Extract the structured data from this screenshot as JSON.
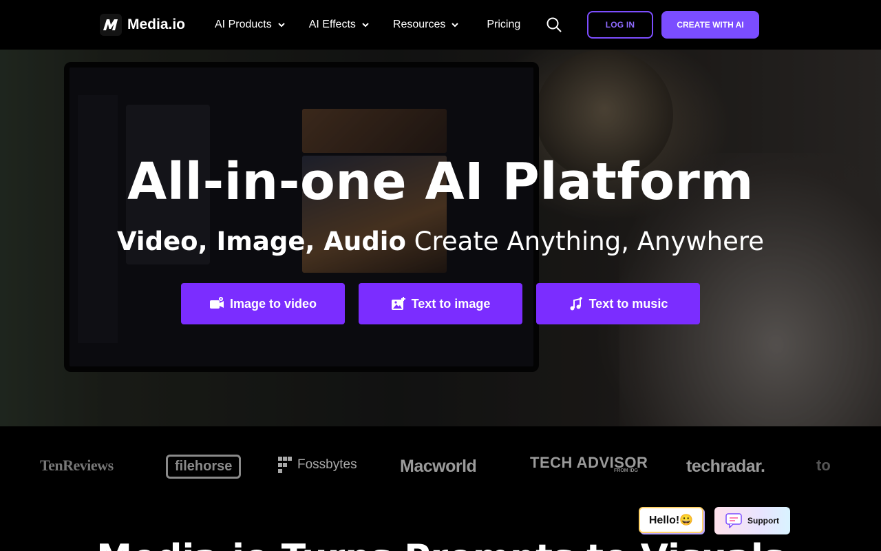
{
  "nav": {
    "brand": "Media.io",
    "menu": [
      {
        "label": "AI Products"
      },
      {
        "label": "AI Effects"
      },
      {
        "label": "Resources"
      },
      {
        "label": "Pricing"
      }
    ],
    "login_label": "LOG IN",
    "create_label": "CREATE WITH AI"
  },
  "hero": {
    "title": "All-in-one AI Platform",
    "subtitle_bold": "Video, Image, Audio",
    "subtitle_rest": " Create Anything, Anywhere",
    "buttons": [
      {
        "label": "Image to video",
        "icon": "video-camera-icon"
      },
      {
        "label": "Text to image",
        "icon": "image-plus-icon"
      },
      {
        "label": "Text to music",
        "icon": "music-note-icon"
      }
    ]
  },
  "press_logos": [
    "TenReviews",
    "filehorse",
    "Fossbytes",
    "Macworld",
    "TECH ADVISOR",
    "FROM IDG",
    "techradar.",
    "to"
  ],
  "peek_heading": "Media.io Turns Prompts to Visuals",
  "chat": {
    "hello": "Hello!😀",
    "support": "Support"
  },
  "colors": {
    "accent": "#7b4dff",
    "cta": "#7b2dff",
    "nav_bg": "#000000"
  }
}
